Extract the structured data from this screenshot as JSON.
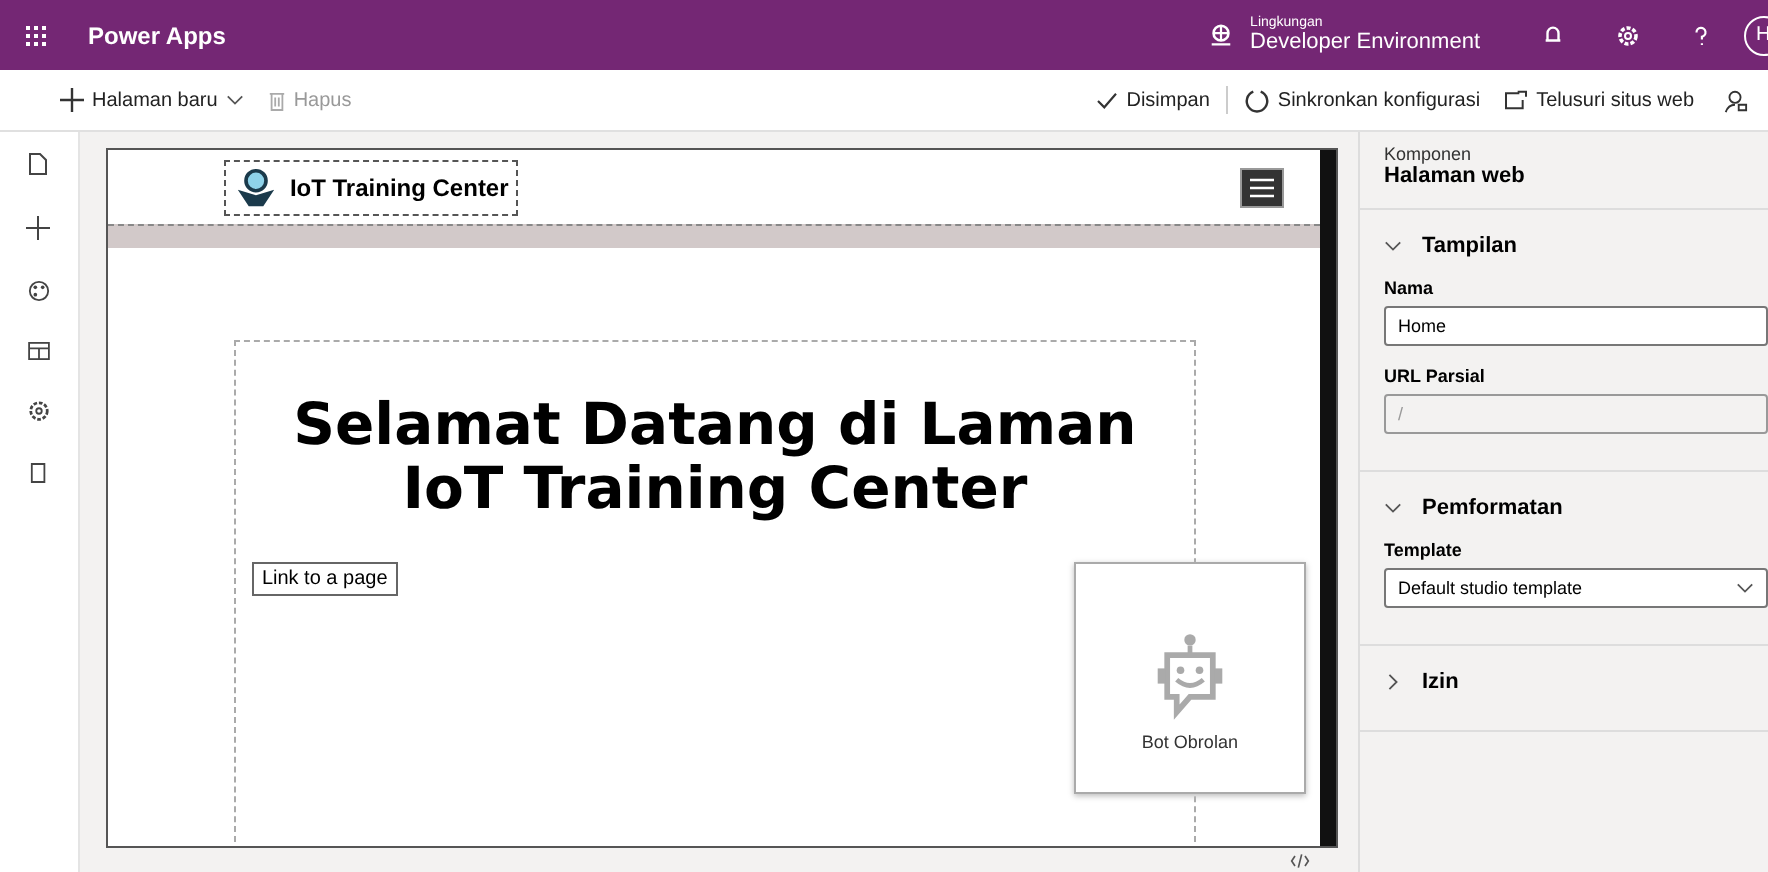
{
  "header": {
    "app_name": "Power Apps",
    "environment_label": "Lingkungan",
    "environment_name": "Developer Environment",
    "avatar": "H"
  },
  "toolbar": {
    "left": [
      {
        "label": "Halaman baru",
        "kind": "new",
        "disabled": false
      },
      {
        "label": "Hapus",
        "kind": "delete",
        "disabled": true
      }
    ],
    "right": [
      {
        "label": "Disimpan",
        "kind": "saved"
      },
      {
        "label": "Sinkronkan konfigurasi",
        "kind": "sync"
      },
      {
        "label": "Telusuri situs web",
        "kind": "browse"
      }
    ]
  },
  "preview": {
    "site_name": "IoT Training Center",
    "heading": "Selamat Datang di Laman IoT Training Center",
    "link": "Link to a page",
    "chatbot": "Bot Obrolan"
  },
  "properties": {
    "component_label": "Komponen",
    "component_name": "Halaman web",
    "sections": [
      {
        "title": "Tampilan",
        "expanded": true,
        "fields": [
          {
            "label": "Nama",
            "value": "Home",
            "kind": "text",
            "disabled": false
          },
          {
            "label": "URL Parsial",
            "placeholder": "/",
            "kind": "text",
            "disabled": true
          }
        ]
      },
      {
        "title": "Pemformatan",
        "expanded": true,
        "fields": [
          {
            "label": "Template",
            "value": "Default studio template",
            "kind": "select"
          }
        ]
      },
      {
        "title": "Izin",
        "expanded": false
      }
    ]
  }
}
